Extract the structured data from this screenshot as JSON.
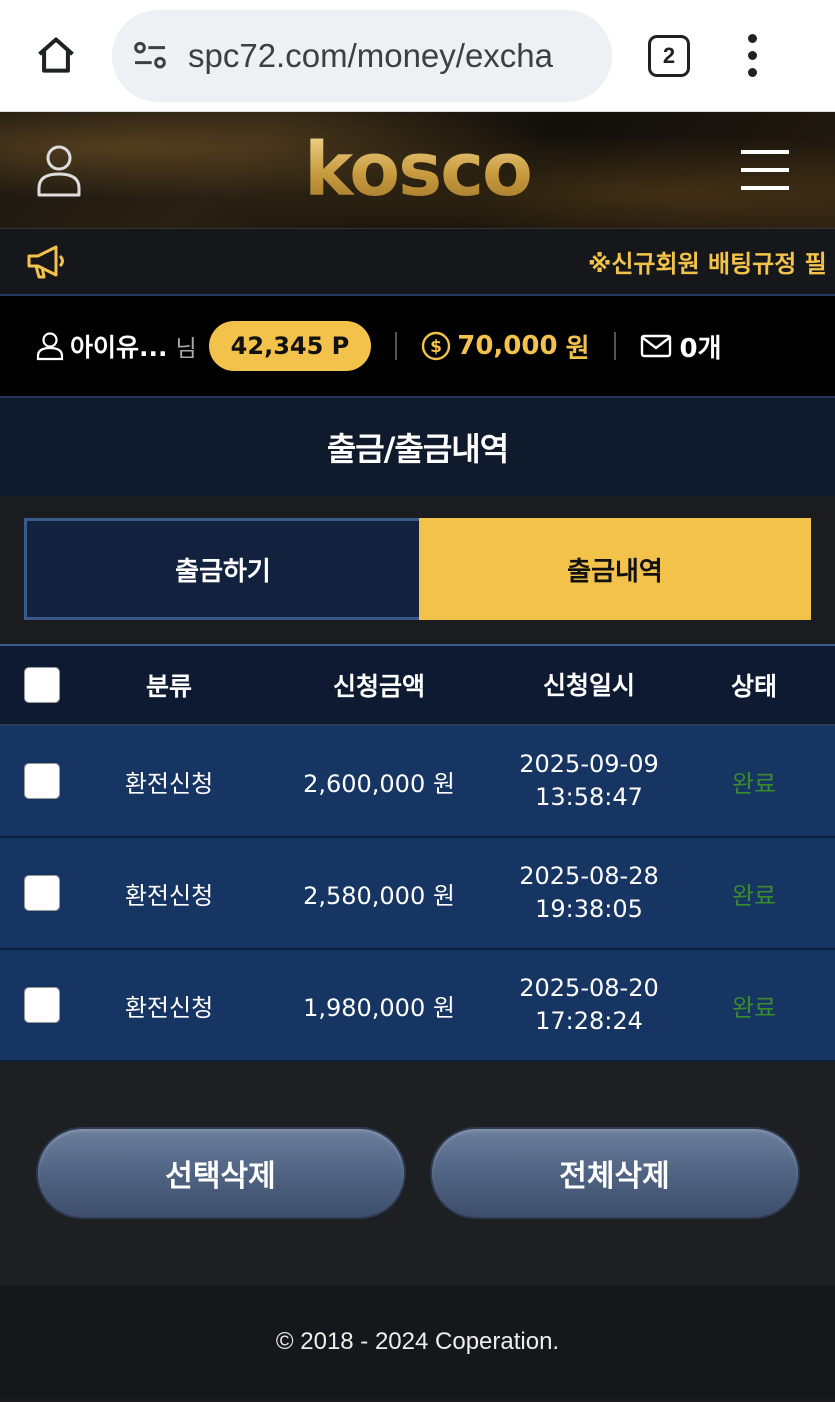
{
  "browser": {
    "url": "spc72.com/money/excha",
    "tab_count": "2"
  },
  "header": {
    "logo": "kosco"
  },
  "notice": {
    "text": "※신규회원 배팅규정 필"
  },
  "user": {
    "name": "아이유...",
    "suffix": "님",
    "points": "42,345 P",
    "money": "70,000",
    "money_unit": "원",
    "messages": "0개"
  },
  "page": {
    "title": "출금/출금내역"
  },
  "tabs": [
    {
      "label": "출금하기",
      "active": false
    },
    {
      "label": "출금내역",
      "active": true
    }
  ],
  "table": {
    "headers": {
      "type": "분류",
      "amount": "신청금액",
      "date": "신청일시",
      "status": "상태"
    },
    "rows": [
      {
        "type": "환전신청",
        "amount": "2,600,000 원",
        "date": "2025-09-09",
        "time": "13:58:47",
        "status": "완료"
      },
      {
        "type": "환전신청",
        "amount": "2,580,000 원",
        "date": "2025-08-28",
        "time": "19:38:05",
        "status": "완료"
      },
      {
        "type": "환전신청",
        "amount": "1,980,000 원",
        "date": "2025-08-20",
        "time": "17:28:24",
        "status": "완료"
      }
    ]
  },
  "buttons": {
    "delete_selected": "선택삭제",
    "delete_all": "전체삭제"
  },
  "footer": {
    "copyright": "© 2018 - 2024 Coperation."
  },
  "colors": {
    "accent_gold": "#f3c24a",
    "status_done": "#3a8b2c",
    "row_bg": "#163562"
  }
}
